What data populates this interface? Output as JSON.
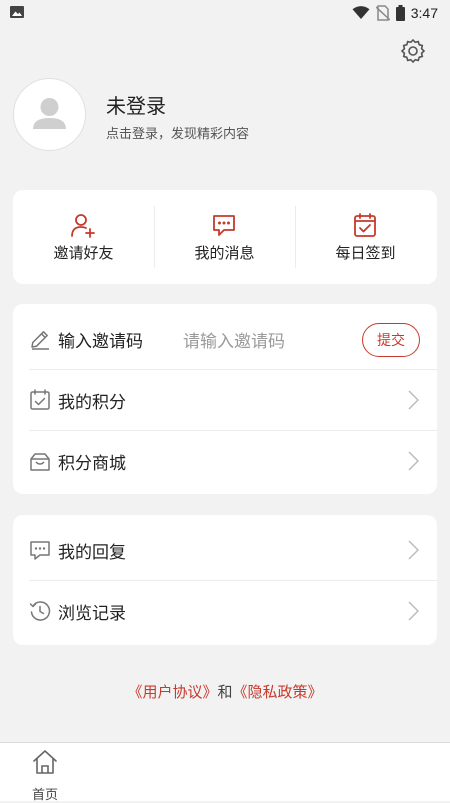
{
  "status_bar": {
    "time": "3:47"
  },
  "profile": {
    "name": "未登录",
    "subtitle": "点击登录，发现精彩内容"
  },
  "quick_actions": [
    {
      "label": "邀请好友",
      "icon": "add-user-icon"
    },
    {
      "label": "我的消息",
      "icon": "message-icon"
    },
    {
      "label": "每日签到",
      "icon": "calendar-check-icon"
    }
  ],
  "invite": {
    "label": "输入邀请码",
    "placeholder": "请输入邀请码",
    "submit": "提交"
  },
  "list1": [
    {
      "label": "我的积分",
      "icon": "points-calendar-icon"
    },
    {
      "label": "积分商城",
      "icon": "gift-box-icon"
    }
  ],
  "list2": [
    {
      "label": "我的回复",
      "icon": "comment-icon"
    },
    {
      "label": "浏览记录",
      "icon": "history-icon"
    }
  ],
  "agreement": {
    "user_agreement": "《用户协议》",
    "and": "和",
    "privacy_policy": "《隐私政策》"
  },
  "tabbar": {
    "home": "首页"
  },
  "colors": {
    "accent": "#c63a2c",
    "background": "#f2f2f2",
    "card": "#ffffff"
  }
}
